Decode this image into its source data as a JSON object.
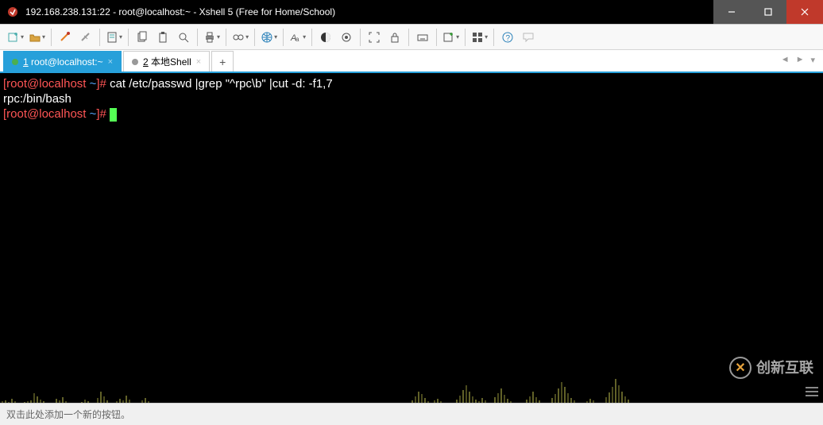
{
  "window": {
    "title": "192.168.238.131:22 - root@localhost:~ - Xshell 5 (Free for Home/School)"
  },
  "tabs": [
    {
      "label_prefix": "1",
      "label_rest": " root@localhost:~",
      "active": true
    },
    {
      "label_prefix": "2",
      "label_rest": " 本地Shell",
      "active": false
    }
  ],
  "terminal": {
    "prompt_user": "root@localhost",
    "prompt_path": "~",
    "command": "cat /etc/passwd |grep \"^rpc\\b\" |cut -d: -f1,7",
    "output": "rpc:/bin/bash"
  },
  "statusbar": {
    "hint": "双击此处添加一个新的按钮。"
  },
  "watermark": {
    "text": "创新互联"
  }
}
